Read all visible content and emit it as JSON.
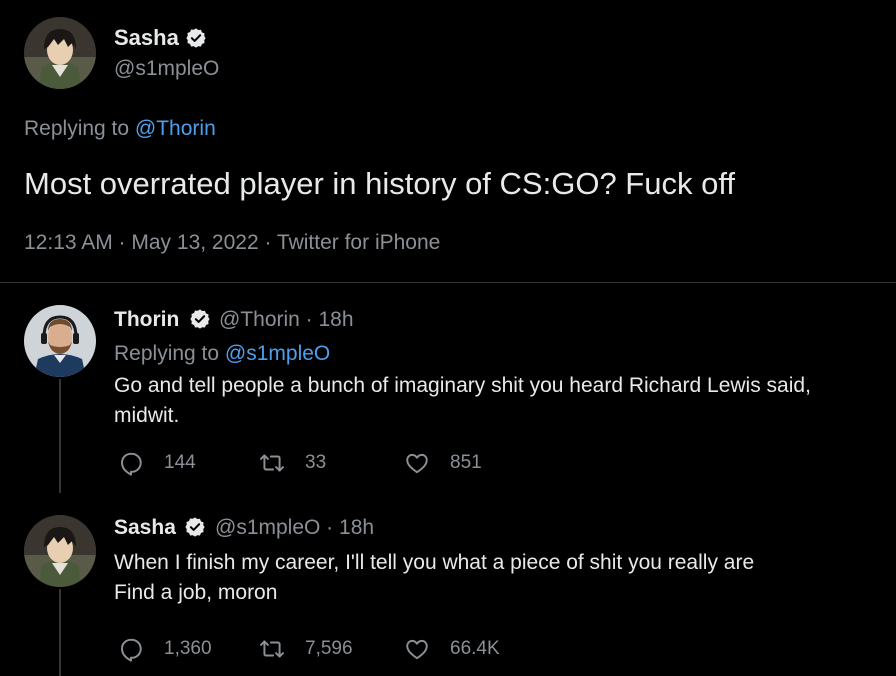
{
  "colors": {
    "background": "#000000",
    "text_primary": "#e7e9ea",
    "text_secondary": "#8b9096",
    "link": "#4d9fec",
    "verified": "#e7e9ea",
    "divider": "#2f3336"
  },
  "main_tweet": {
    "display_name": "Sasha",
    "handle": "@s1mpleO",
    "replying_prefix": "Replying to ",
    "replying_to": "@Thorin",
    "text": "Most overrated player in history of CS:GO? Fuck off",
    "meta": "12:13 AM · May 13, 2022 · Twitter for iPhone"
  },
  "replies": [
    {
      "display_name": "Thorin",
      "handle_time": "@Thorin · 18h",
      "replying_prefix": "Replying to ",
      "replying_to": "@s1mpleO",
      "lines": [
        "Go and tell people a bunch of imaginary shit you heard Richard Lewis said,",
        "midwit."
      ],
      "reply_count": "144",
      "retweet_count": "33",
      "like_count": "851"
    },
    {
      "display_name": "Sasha",
      "handle_time": "@s1mpleO · 18h",
      "lines": [
        "When I finish my career, I'll tell you what a piece of shit you really are",
        "Find a job, moron"
      ],
      "reply_count": "1,360",
      "retweet_count": "7,596",
      "like_count": "66.4K"
    }
  ],
  "icons": {
    "verified": "verified-badge-icon",
    "reply": "reply-bubble-icon",
    "retweet": "retweet-icon",
    "like": "heart-icon"
  }
}
